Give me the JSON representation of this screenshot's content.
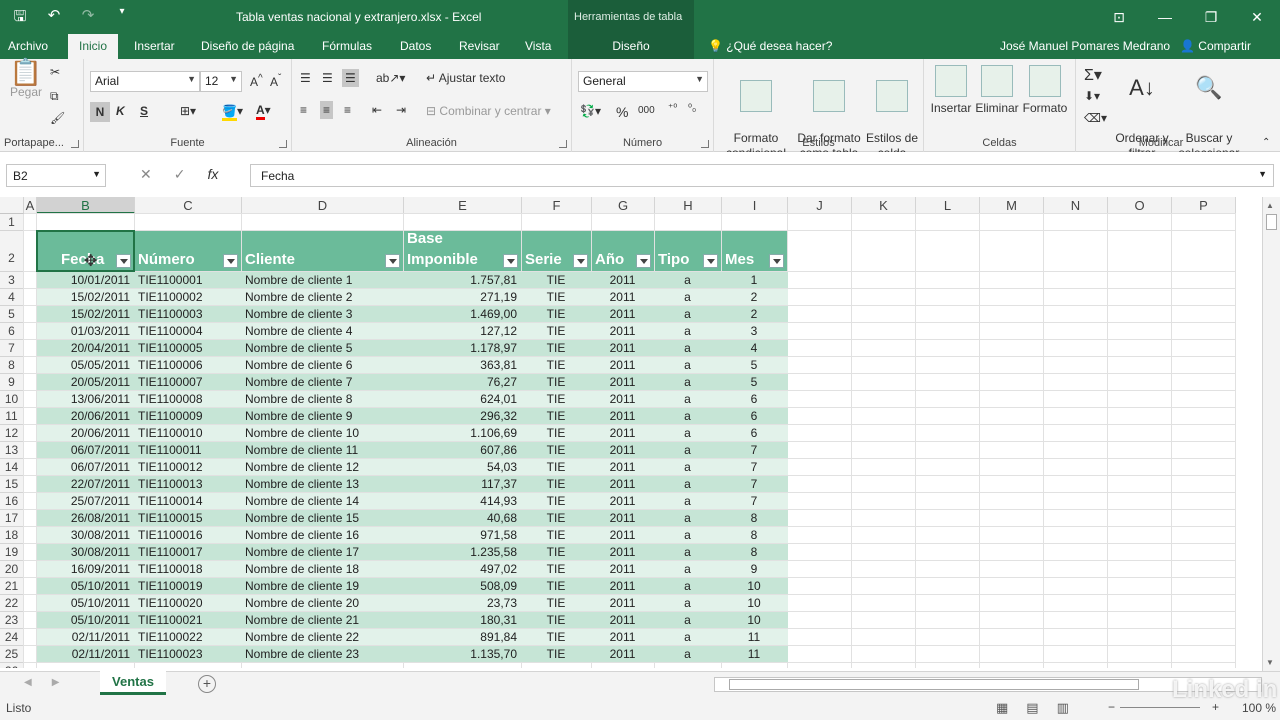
{
  "app": {
    "window_title": "Tabla ventas nacional y extranjero.xlsx - Excel",
    "context_tools": "Herramientas de tabla",
    "accent": "#217346"
  },
  "tabs": [
    "Archivo",
    "Inicio",
    "Insertar",
    "Diseño de página",
    "Fórmulas",
    "Datos",
    "Revisar",
    "Vista",
    "Diseño"
  ],
  "active_tab": "Inicio",
  "tell_me": "¿Qué desea hacer?",
  "user": "José Manuel Pomares Medrano",
  "share": "Compartir",
  "ribbon": {
    "clipboard": {
      "paste": "Pegar",
      "label": "Portapape..."
    },
    "font": {
      "name": "Arial",
      "size": "12",
      "label": "Fuente",
      "bold": "N",
      "italic": "K",
      "underline": "S"
    },
    "alignment": {
      "wrap": "Ajustar texto",
      "merge": "Combinar y centrar",
      "label": "Alineación"
    },
    "number": {
      "format": "General",
      "label": "Número"
    },
    "styles": {
      "conditional": "Formato\ncondicional",
      "table": "Dar formato\ncomo tabla",
      "cell": "Estilos de\ncelda",
      "label": "Estilos"
    },
    "cells": {
      "insert": "Insertar",
      "delete": "Eliminar",
      "format": "Formato",
      "label": "Celdas"
    },
    "editing": {
      "sort": "Ordenar y\nfiltrar",
      "find": "Buscar y\nseleccionar",
      "label": "Modificar"
    }
  },
  "formula_bar": {
    "name_box": "B2",
    "fx": "fx",
    "content": "Fecha"
  },
  "columns": [
    "A",
    "B",
    "C",
    "D",
    "E",
    "F",
    "G",
    "H",
    "I",
    "J",
    "K",
    "L",
    "M",
    "N",
    "O",
    "P"
  ],
  "table": {
    "headers": [
      "Fecha",
      "Número",
      "Cliente",
      "Base\nImponible",
      "Serie",
      "Año",
      "Tipo",
      "Mes"
    ],
    "rows": [
      [
        "10/01/2011",
        "TIE1100001",
        "Nombre de cliente 1",
        "1.757,81",
        "TIE",
        "2011",
        "a",
        "1"
      ],
      [
        "15/02/2011",
        "TIE1100002",
        "Nombre de cliente 2",
        "271,19",
        "TIE",
        "2011",
        "a",
        "2"
      ],
      [
        "15/02/2011",
        "TIE1100003",
        "Nombre de cliente 3",
        "1.469,00",
        "TIE",
        "2011",
        "a",
        "2"
      ],
      [
        "01/03/2011",
        "TIE1100004",
        "Nombre de cliente 4",
        "127,12",
        "TIE",
        "2011",
        "a",
        "3"
      ],
      [
        "20/04/2011",
        "TIE1100005",
        "Nombre de cliente 5",
        "1.178,97",
        "TIE",
        "2011",
        "a",
        "4"
      ],
      [
        "05/05/2011",
        "TIE1100006",
        "Nombre de cliente 6",
        "363,81",
        "TIE",
        "2011",
        "a",
        "5"
      ],
      [
        "20/05/2011",
        "TIE1100007",
        "Nombre de cliente 7",
        "76,27",
        "TIE",
        "2011",
        "a",
        "5"
      ],
      [
        "13/06/2011",
        "TIE1100008",
        "Nombre de cliente 8",
        "624,01",
        "TIE",
        "2011",
        "a",
        "6"
      ],
      [
        "20/06/2011",
        "TIE1100009",
        "Nombre de cliente 9",
        "296,32",
        "TIE",
        "2011",
        "a",
        "6"
      ],
      [
        "20/06/2011",
        "TIE1100010",
        "Nombre de cliente 10",
        "1.106,69",
        "TIE",
        "2011",
        "a",
        "6"
      ],
      [
        "06/07/2011",
        "TIE1100011",
        "Nombre de cliente 11",
        "607,86",
        "TIE",
        "2011",
        "a",
        "7"
      ],
      [
        "06/07/2011",
        "TIE1100012",
        "Nombre de cliente 12",
        "54,03",
        "TIE",
        "2011",
        "a",
        "7"
      ],
      [
        "22/07/2011",
        "TIE1100013",
        "Nombre de cliente 13",
        "117,37",
        "TIE",
        "2011",
        "a",
        "7"
      ],
      [
        "25/07/2011",
        "TIE1100014",
        "Nombre de cliente 14",
        "414,93",
        "TIE",
        "2011",
        "a",
        "7"
      ],
      [
        "26/08/2011",
        "TIE1100015",
        "Nombre de cliente 15",
        "40,68",
        "TIE",
        "2011",
        "a",
        "8"
      ],
      [
        "30/08/2011",
        "TIE1100016",
        "Nombre de cliente 16",
        "971,58",
        "TIE",
        "2011",
        "a",
        "8"
      ],
      [
        "30/08/2011",
        "TIE1100017",
        "Nombre de cliente 17",
        "1.235,58",
        "TIE",
        "2011",
        "a",
        "8"
      ],
      [
        "16/09/2011",
        "TIE1100018",
        "Nombre de cliente 18",
        "497,02",
        "TIE",
        "2011",
        "a",
        "9"
      ],
      [
        "05/10/2011",
        "TIE1100019",
        "Nombre de cliente 19",
        "508,09",
        "TIE",
        "2011",
        "a",
        "10"
      ],
      [
        "05/10/2011",
        "TIE1100020",
        "Nombre de cliente 20",
        "23,73",
        "TIE",
        "2011",
        "a",
        "10"
      ],
      [
        "05/10/2011",
        "TIE1100021",
        "Nombre de cliente 21",
        "180,31",
        "TIE",
        "2011",
        "a",
        "10"
      ],
      [
        "02/11/2011",
        "TIE1100022",
        "Nombre de cliente 22",
        "891,84",
        "TIE",
        "2011",
        "a",
        "11"
      ],
      [
        "02/11/2011",
        "TIE1100023",
        "Nombre de cliente 23",
        "1.135,70",
        "TIE",
        "2011",
        "a",
        "11"
      ]
    ]
  },
  "sheet_tab": "Ventas",
  "status": {
    "ready": "Listo",
    "zoom": "100 %"
  },
  "watermark": "Linked in"
}
